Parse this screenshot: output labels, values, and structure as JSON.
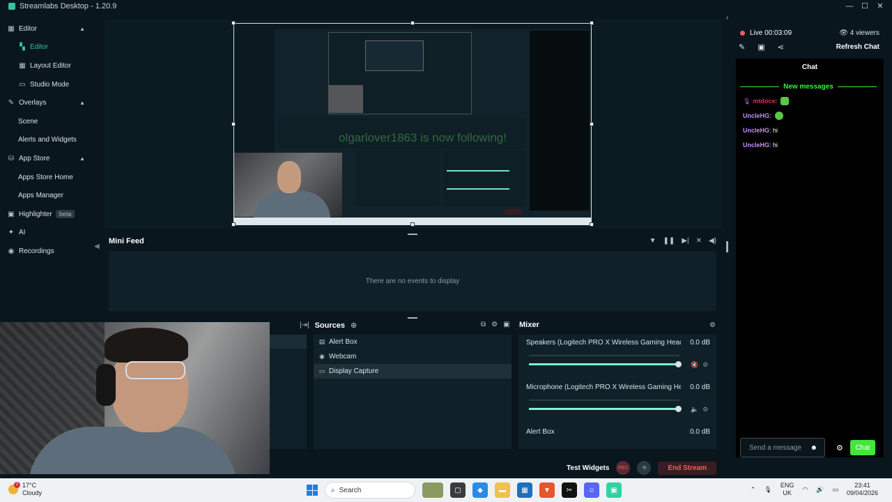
{
  "app": {
    "title": "Streamlabs Desktop - 1.20.9"
  },
  "window_controls": {
    "minimize": "—",
    "maximize": "☐",
    "close": "✕"
  },
  "sidebar": {
    "items": [
      {
        "label": "Editor",
        "type": "section",
        "icon": "grid-icon"
      },
      {
        "label": "Editor",
        "type": "sub",
        "active": true,
        "icon": "editor-icon"
      },
      {
        "label": "Layout Editor",
        "type": "sub",
        "icon": "layout-icon"
      },
      {
        "label": "Studio Mode",
        "type": "sub",
        "icon": "studio-icon"
      },
      {
        "label": "Overlays",
        "type": "section",
        "icon": "brush-icon"
      },
      {
        "label": "Scene",
        "type": "sub"
      },
      {
        "label": "Alerts and Widgets",
        "type": "sub"
      },
      {
        "label": "App Store",
        "type": "section",
        "icon": "store-icon"
      },
      {
        "label": "Apps Store Home",
        "type": "sub"
      },
      {
        "label": "Apps Manager",
        "type": "sub"
      },
      {
        "label": "Highlighter",
        "type": "section",
        "icon": "highlighter-icon",
        "badge": "beta"
      },
      {
        "label": "AI",
        "type": "section",
        "icon": "ai-icon"
      },
      {
        "label": "Recordings",
        "type": "section",
        "icon": "record-icon"
      }
    ]
  },
  "preview": {
    "follow_alert": "olgarlover1863 is now following!"
  },
  "minifeed": {
    "title": "Mini Feed",
    "empty_text": "There are no events to display"
  },
  "sources": {
    "title": "Sources",
    "items": [
      {
        "label": "Alert Box",
        "icon": "widget-icon"
      },
      {
        "label": "Webcam",
        "icon": "webcam-icon"
      },
      {
        "label": "Display Capture",
        "icon": "monitor-icon",
        "selected": true
      }
    ]
  },
  "mixer": {
    "title": "Mixer",
    "channels": [
      {
        "name": "Speakers (Logitech PRO X Wireless Gaming Headset)",
        "db": "0.0 dB",
        "level": 0.99
      },
      {
        "name": "Microphone (Logitech PRO X Wireless Gaming Head...",
        "db": "0.0 dB",
        "level": 0.99
      },
      {
        "name": "Alert Box",
        "db": "0.0 dB"
      }
    ]
  },
  "stream_bar": {
    "test_widgets": "Test Widgets",
    "end_stream": "End Stream",
    "rec_label": "REC"
  },
  "chat": {
    "live_time": "Live 00:03:09",
    "viewers": "4 viewers",
    "refresh": "Refresh Chat",
    "title": "Chat",
    "new_messages": "New messages",
    "messages": [
      {
        "user": "mtdoce",
        "text": "",
        "emote": true
      },
      {
        "user": "UncleHG",
        "text": "",
        "emote": true
      },
      {
        "user": "UncleHG",
        "text": "hi"
      },
      {
        "user": "UncleHG",
        "text": "hi"
      }
    ],
    "placeholder": "Send a message",
    "send_label": "Chat"
  },
  "taskbar": {
    "weather_temp": "17°C",
    "weather_desc": "Cloudy",
    "notif_count": "2",
    "search": "Search",
    "lang1": "ENG",
    "lang2": "UK",
    "time": "23:41",
    "date": "09/04/2026"
  },
  "colors": {
    "accent": "#31c3a2",
    "live": "#f25b5b",
    "chat_green": "#42e63c",
    "user_purple": "#c28ff7"
  }
}
